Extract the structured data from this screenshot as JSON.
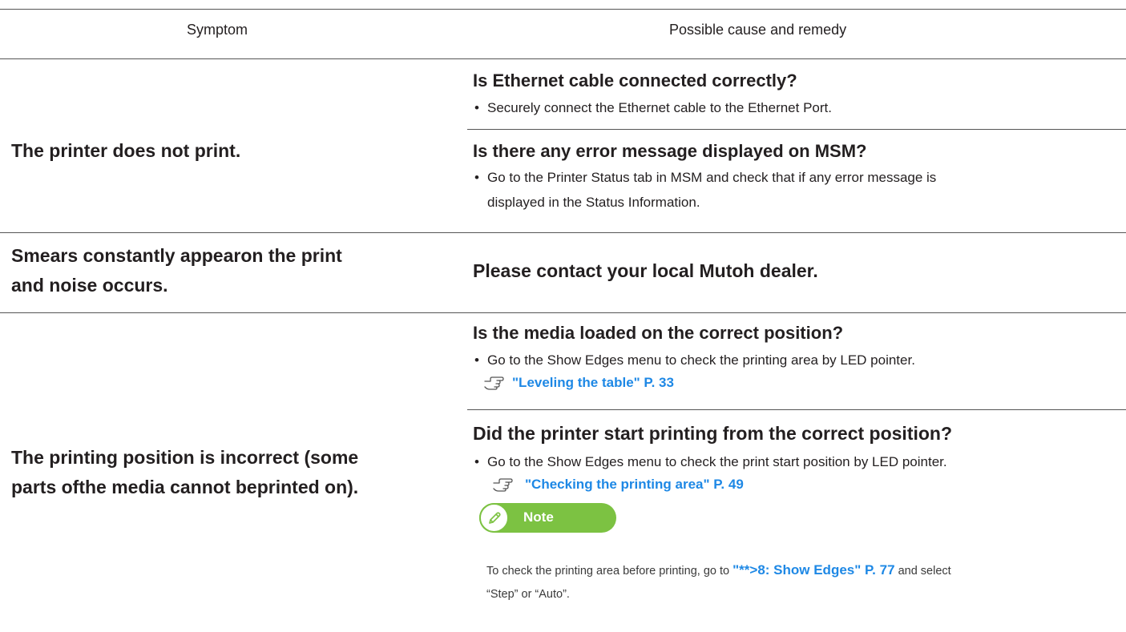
{
  "header": {
    "symptom": "Symptom",
    "remedy": "Possible cause and remedy"
  },
  "rows": [
    {
      "symptom": "The printer does not print.",
      "items": [
        {
          "question": "Is Ethernet cable connected correctly?",
          "bullets": [
            "Securely connect the Ethernet cable to the Ethernet Port."
          ]
        },
        {
          "question": "Is there any error message displayed on MSM?",
          "bullets": [
            "Go to the Printer Status tab in MSM and check that if any error message is",
            "displayed in the Status Information."
          ]
        }
      ]
    },
    {
      "symptom_lines": [
        "Smears constantly appearon the print",
        "and noise occurs."
      ],
      "items": [
        {
          "question": "Please contact your local Mutoh dealer."
        }
      ]
    },
    {
      "symptom_lines": [
        "The printing position is incorrect (some",
        "parts ofthe media cannot beprinted on)."
      ],
      "items": [
        {
          "question": "Is the media loaded on the correct position?",
          "bullets": [
            "Go to the Show Edges menu to check the printing area by LED pointer."
          ],
          "reference": "\"Leveling the table\" P. 33"
        },
        {
          "question": "Did the printer start printing from the correct position?",
          "bullets": [
            "Go to the Show Edges menu to check the print start position by LED pointer."
          ],
          "reference": "\"Checking the printing area\" P. 49"
        }
      ],
      "note": {
        "label": "Note",
        "text_before": "To check the printing area before printing, go to",
        "link": "\"**>8: Show Edges\" P. 77",
        "text_after": "and select",
        "text_line2": "“Step” or “Auto”."
      }
    }
  ],
  "bullet_char": "•",
  "icons": {
    "reference": "pointing-hand-icon",
    "note": "pencil-icon"
  },
  "colors": {
    "link": "#1e88e5",
    "note_badge": "#7cc242",
    "rule": "#555555",
    "text": "#231f20"
  }
}
